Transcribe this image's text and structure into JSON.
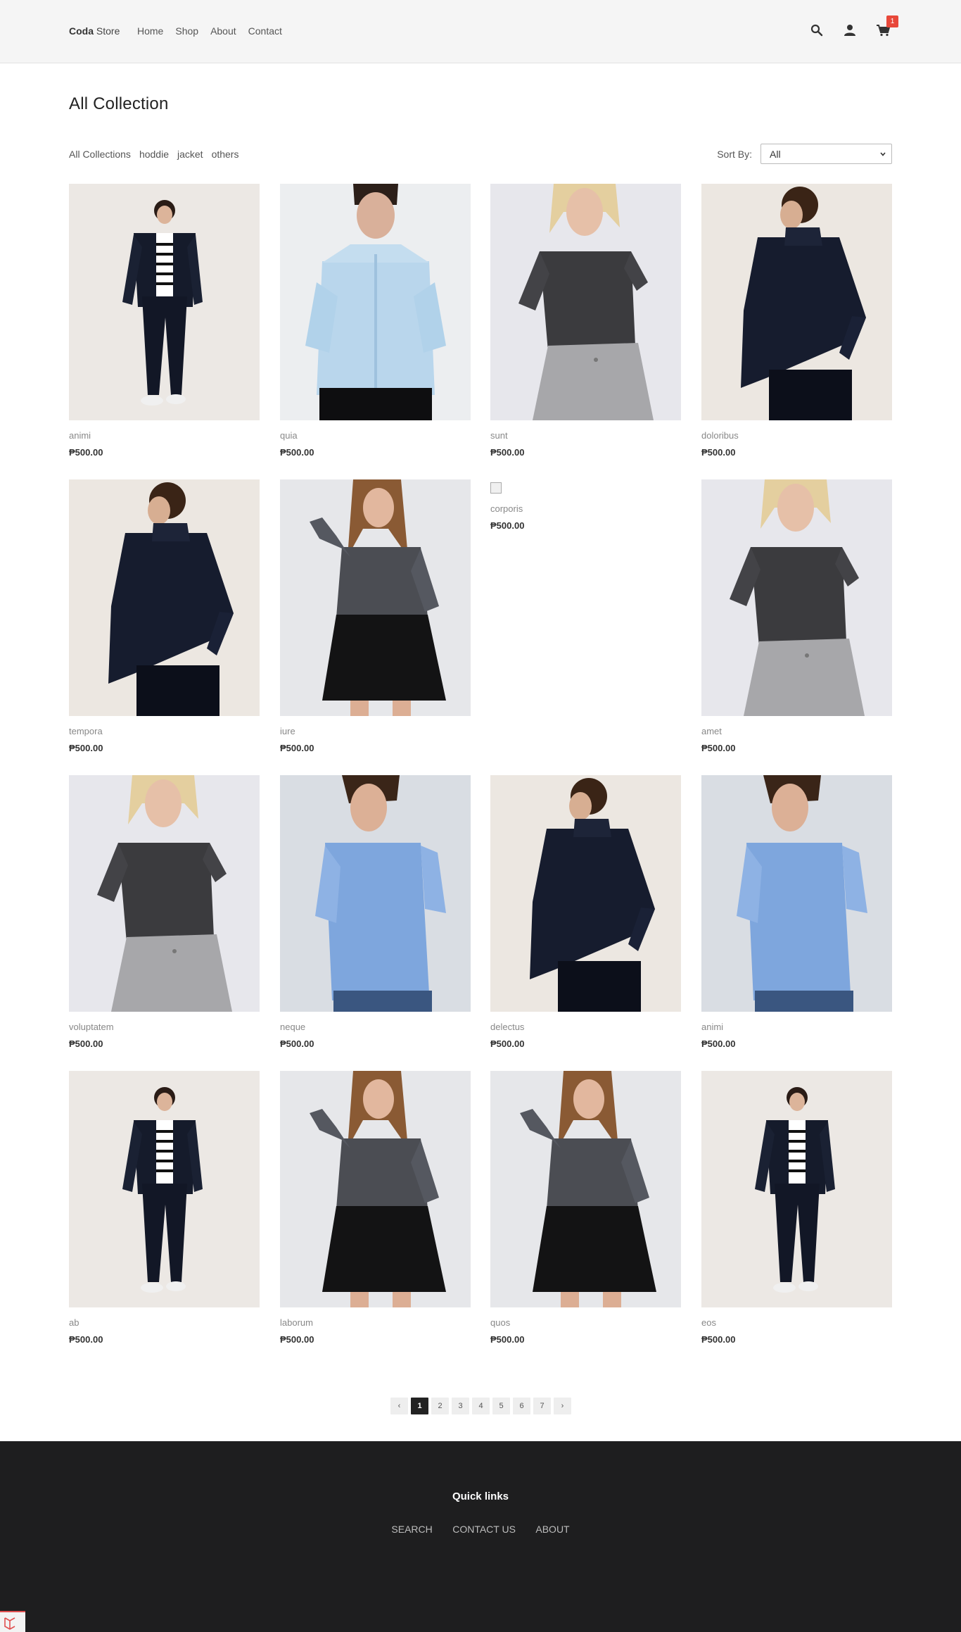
{
  "header": {
    "brand_bold": "Coda",
    "brand_rest": " Store",
    "nav": [
      "Home",
      "Shop",
      "About",
      "Contact"
    ],
    "cart_count": "1",
    "icons": [
      "search-icon",
      "user-icon",
      "cart-icon"
    ]
  },
  "page": {
    "title": "All Collection"
  },
  "filters": {
    "categories": [
      "All Collections",
      "hoddie",
      "jacket",
      "others"
    ],
    "sort_label": "Sort By:",
    "sort_value": "All"
  },
  "products": [
    {
      "name": "animi",
      "price": "₱500.00",
      "img": "man-stripe"
    },
    {
      "name": "quia",
      "price": "₱500.00",
      "img": "man-light-shirt"
    },
    {
      "name": "sunt",
      "price": "₱500.00",
      "img": "woman-tee"
    },
    {
      "name": "doloribus",
      "price": "₱500.00",
      "img": "man-jacket-back"
    },
    {
      "name": "tempora",
      "price": "₱500.00",
      "img": "man-jacket-back"
    },
    {
      "name": "iure",
      "price": "₱500.00",
      "img": "woman-skirt"
    },
    {
      "name": "corporis",
      "price": "₱500.00",
      "img": "broken"
    },
    {
      "name": "amet",
      "price": "₱500.00",
      "img": "woman-tee"
    },
    {
      "name": "voluptatem",
      "price": "₱500.00",
      "img": "woman-tee"
    },
    {
      "name": "neque",
      "price": "₱500.00",
      "img": "man-check"
    },
    {
      "name": "delectus",
      "price": "₱500.00",
      "img": "man-jacket-back"
    },
    {
      "name": "animi",
      "price": "₱500.00",
      "img": "man-check"
    },
    {
      "name": "ab",
      "price": "₱500.00",
      "img": "man-stripe"
    },
    {
      "name": "laborum",
      "price": "₱500.00",
      "img": "woman-skirt"
    },
    {
      "name": "quos",
      "price": "₱500.00",
      "img": "woman-skirt"
    },
    {
      "name": "eos",
      "price": "₱500.00",
      "img": "man-stripe"
    }
  ],
  "pagination": {
    "prev": "‹",
    "pages": [
      "1",
      "2",
      "3",
      "4",
      "5",
      "6",
      "7"
    ],
    "current": "1",
    "next": "›"
  },
  "footer": {
    "title": "Quick links",
    "links": [
      "SEARCH",
      "CONTACT US",
      "ABOUT"
    ]
  },
  "colors": {
    "header_bg": "#f5f5f5",
    "footer_bg": "#1e1e1f",
    "badge": "#e8483a",
    "active_page": "#222222"
  }
}
